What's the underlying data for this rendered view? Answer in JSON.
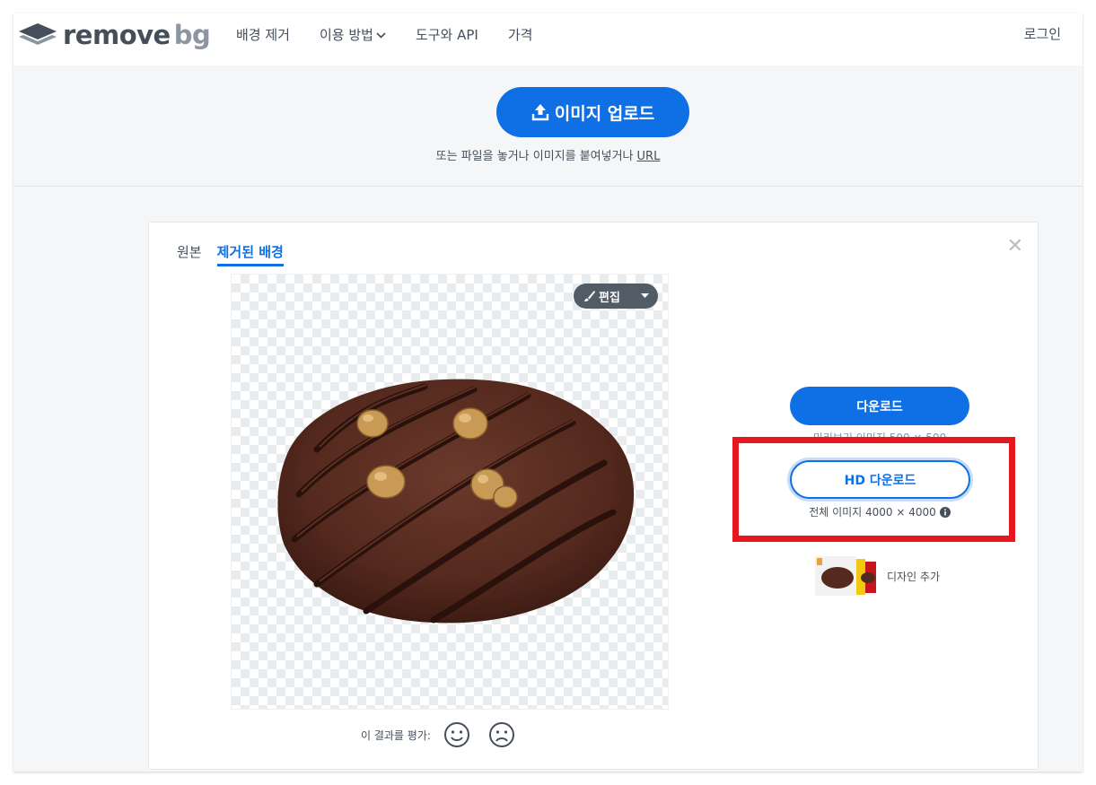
{
  "header": {
    "logo": {
      "word1": "remove",
      "word2": "bg"
    },
    "nav": [
      {
        "label": "배경 제거"
      },
      {
        "label": "이용 방법"
      },
      {
        "label": "도구와 API"
      },
      {
        "label": "가격"
      }
    ],
    "login": "로그인"
  },
  "upload": {
    "button_label": "이미지 업로드",
    "hint": "또는 파일을 놓거나 이미지를 붙여넣거나",
    "hint_link": "URL"
  },
  "result": {
    "tabs": [
      {
        "label": "원본",
        "active": false
      },
      {
        "label": "제거된 배경",
        "active": true
      }
    ],
    "edit_label": "편집",
    "rate_label": "이 결과를 평가:",
    "download_label": "다운로드",
    "download_sub": "미리보기 이미지 500 × 500",
    "hd_download_label": "HD 다운로드",
    "hd_download_sub": "전체 이미지 4000 × 4000",
    "design_label": "디자인 추가"
  },
  "colors": {
    "accent": "#0f70e6",
    "highlight": "#e6171f",
    "text": "#454f5b"
  },
  "icons": [
    "layers-logo-icon",
    "chevron-down-icon",
    "upload-icon",
    "close-icon",
    "brush-icon",
    "caret-down-icon",
    "smile-icon",
    "frown-icon",
    "info-icon"
  ]
}
